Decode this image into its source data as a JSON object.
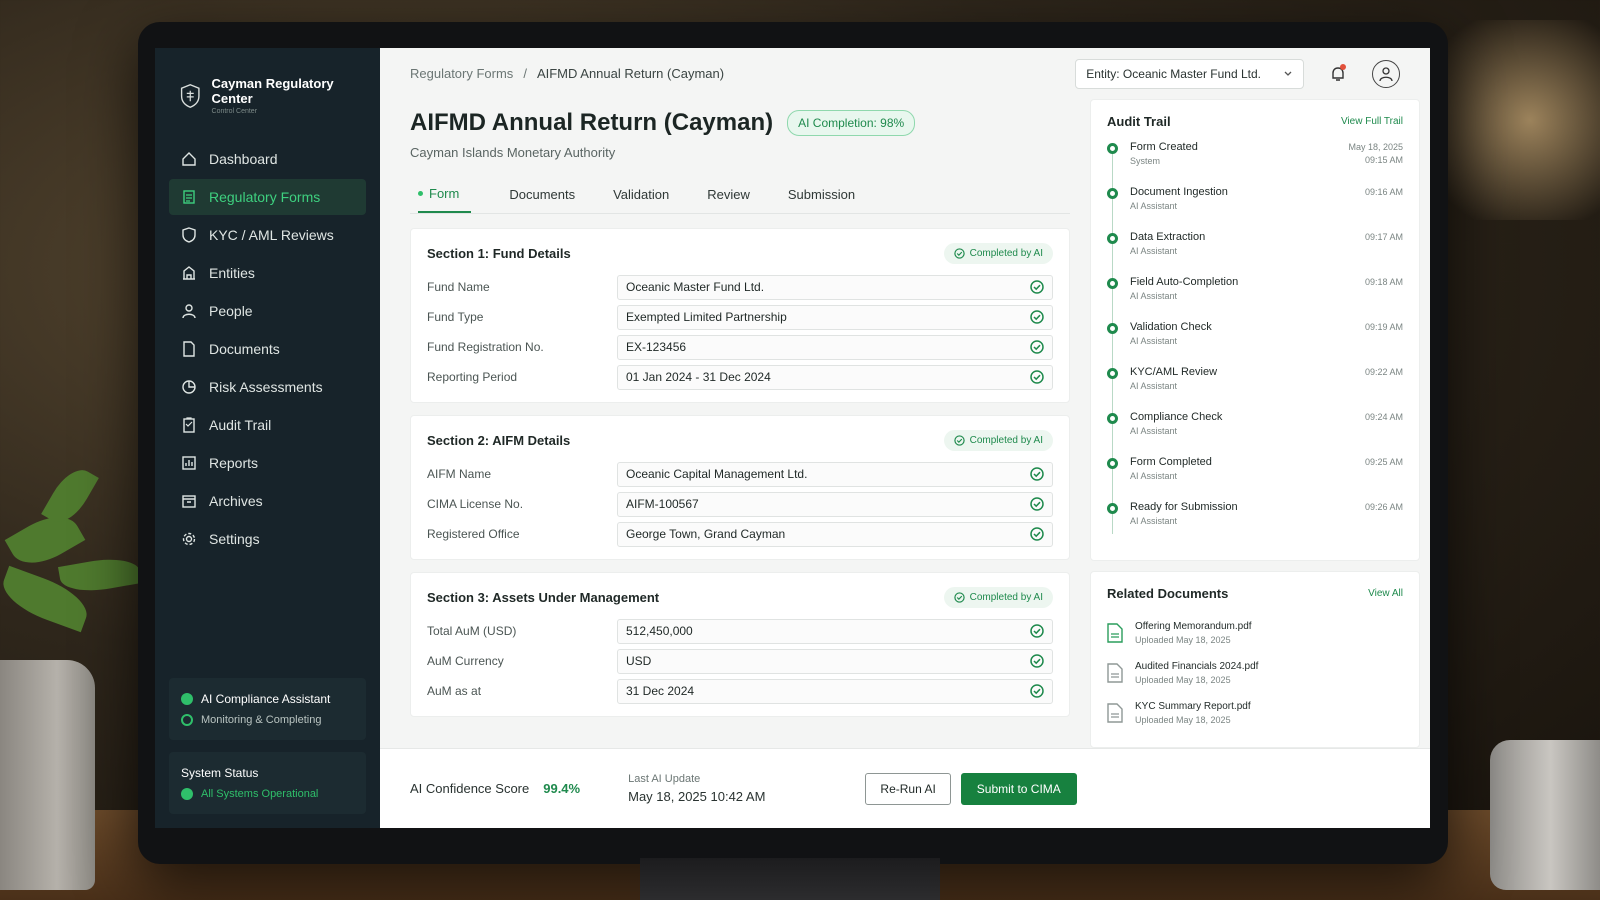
{
  "brand": {
    "title": "Cayman Regulatory Center",
    "subtitle": "Control Center"
  },
  "sidebar": {
    "items": [
      {
        "label": "Dashboard",
        "icon": "home-icon"
      },
      {
        "label": "Regulatory Forms",
        "icon": "form-icon",
        "active": true
      },
      {
        "label": "KYC / AML Reviews",
        "icon": "shield-icon"
      },
      {
        "label": "Entities",
        "icon": "building-icon"
      },
      {
        "label": "People",
        "icon": "person-icon"
      },
      {
        "label": "Documents",
        "icon": "document-icon"
      },
      {
        "label": "Risk Assessments",
        "icon": "risk-icon"
      },
      {
        "label": "Audit Trail",
        "icon": "audit-icon"
      },
      {
        "label": "Reports",
        "icon": "report-icon"
      },
      {
        "label": "Archives",
        "icon": "archive-icon"
      },
      {
        "label": "Settings",
        "icon": "gear-icon"
      }
    ],
    "assistant": {
      "title": "AI Compliance Assistant",
      "status": "Monitoring & Completing"
    },
    "system": {
      "title": "System Status",
      "status": "All Systems Operational"
    }
  },
  "breadcrumb": {
    "parent": "Regulatory Forms",
    "separator": "/",
    "current": "AIFMD Annual Return (Cayman)"
  },
  "entity": {
    "label": "Entity: Oceanic Master Fund Ltd."
  },
  "page": {
    "title": "AIFMD Annual Return (Cayman)",
    "badge": "AI Completion: 98%",
    "authority": "Cayman Islands Monetary Authority"
  },
  "tabs": [
    {
      "label": "Form",
      "active": true
    },
    {
      "label": "Documents"
    },
    {
      "label": "Validation"
    },
    {
      "label": "Review"
    },
    {
      "label": "Submission"
    }
  ],
  "sections": [
    {
      "title": "Section 1: Fund Details",
      "badge": "Completed by AI",
      "fields": [
        {
          "label": "Fund Name",
          "value": "Oceanic Master Fund Ltd."
        },
        {
          "label": "Fund Type",
          "value": "Exempted Limited Partnership"
        },
        {
          "label": "Fund Registration No.",
          "value": "EX-123456"
        },
        {
          "label": "Reporting Period",
          "value": "01 Jan 2024 - 31 Dec 2024"
        }
      ]
    },
    {
      "title": "Section 2: AIFM Details",
      "badge": "Completed by AI",
      "fields": [
        {
          "label": "AIFM Name",
          "value": "Oceanic Capital Management Ltd."
        },
        {
          "label": "CIMA License No.",
          "value": "AIFM-100567"
        },
        {
          "label": "Registered Office",
          "value": "George Town, Grand Cayman"
        }
      ]
    },
    {
      "title": "Section 3: Assets Under Management",
      "badge": "Completed by AI",
      "fields": [
        {
          "label": "Total AuM (USD)",
          "value": "512,450,000"
        },
        {
          "label": "AuM Currency",
          "value": "USD"
        },
        {
          "label": "AuM as at",
          "value": "31 Dec 2024"
        }
      ]
    }
  ],
  "footer": {
    "confidence_label": "AI Confidence Score",
    "confidence_value": "99.4%",
    "last_update_label": "Last AI Update",
    "last_update_value": "May 18, 2025 10:42 AM",
    "rerun_label": "Re-Run AI",
    "submit_label": "Submit to CIMA"
  },
  "audit": {
    "title": "Audit Trail",
    "link": "View Full Trail",
    "items": [
      {
        "name": "Form Created",
        "actor": "System",
        "date": "May 18, 2025",
        "time": "09:15 AM"
      },
      {
        "name": "Document Ingestion",
        "actor": "AI Assistant",
        "date": "",
        "time": "09:16 AM"
      },
      {
        "name": "Data Extraction",
        "actor": "AI Assistant",
        "date": "",
        "time": "09:17 AM"
      },
      {
        "name": "Field Auto-Completion",
        "actor": "AI Assistant",
        "date": "",
        "time": "09:18 AM"
      },
      {
        "name": "Validation Check",
        "actor": "AI Assistant",
        "date": "",
        "time": "09:19 AM"
      },
      {
        "name": "KYC/AML Review",
        "actor": "AI Assistant",
        "date": "",
        "time": "09:22 AM"
      },
      {
        "name": "Compliance Check",
        "actor": "AI Assistant",
        "date": "",
        "time": "09:24 AM"
      },
      {
        "name": "Form Completed",
        "actor": "AI Assistant",
        "date": "",
        "time": "09:25 AM"
      },
      {
        "name": "Ready for Submission",
        "actor": "AI Assistant",
        "date": "",
        "time": "09:26 AM"
      }
    ]
  },
  "related": {
    "title": "Related Documents",
    "link": "View All",
    "items": [
      {
        "name": "Offering Memorandum.pdf",
        "date": "Uploaded May 18, 2025",
        "icon": "pdf-icon",
        "color": "#2a9d5c"
      },
      {
        "name": "Audited Financials 2024.pdf",
        "date": "Uploaded May 18, 2025",
        "icon": "pdf-icon",
        "color": "#8f9896"
      },
      {
        "name": "KYC Summary Report.pdf",
        "date": "Uploaded May 18, 2025",
        "icon": "pdf-icon",
        "color": "#8f9896"
      }
    ]
  },
  "colors": {
    "accent": "#1f8a4d",
    "sidebar": "#17232a",
    "active_nav": "#3ed07f"
  }
}
